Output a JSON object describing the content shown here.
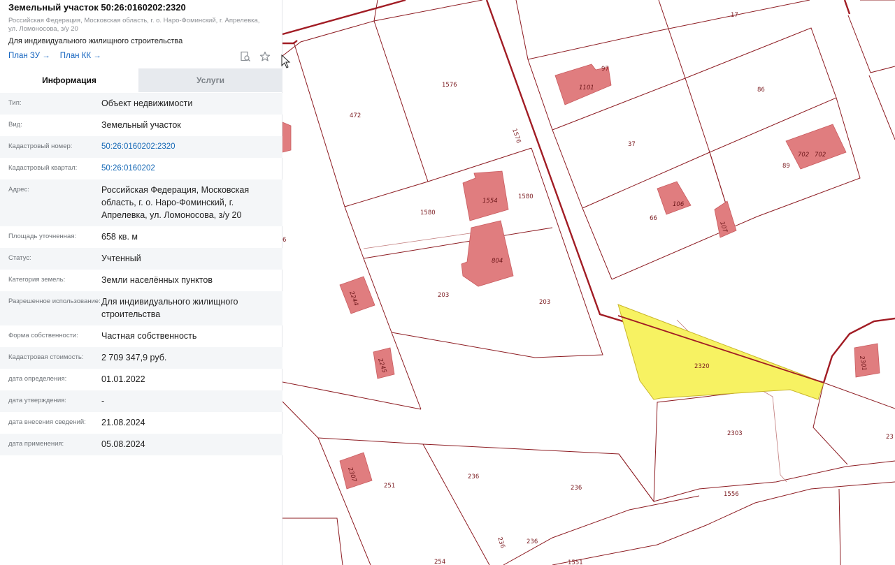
{
  "header": {
    "title": "Земельный участок 50:26:0160202:2320",
    "address": "Российская Федерация, Московская область, г. о. Наро-Фоминский, г. Апрелевка, ул. Ломоносова, з/у 20",
    "usage": "Для индивидуального жилищного строительства",
    "link_zu": "План ЗУ →",
    "link_kk": "План КК →",
    "icons": [
      "search-document-icon",
      "star-icon"
    ]
  },
  "tabs": [
    {
      "label": "Информация",
      "active": true
    },
    {
      "label": "Услуги",
      "active": false
    }
  ],
  "info": [
    {
      "label": "Тип:",
      "value": "Объект недвижимости"
    },
    {
      "label": "Вид:",
      "value": "Земельный участок"
    },
    {
      "label": "Кадастровый номер:",
      "value": "50:26:0160202:2320",
      "link": true
    },
    {
      "label": "Кадастровый квартал:",
      "value": "50:26:0160202",
      "link": true
    },
    {
      "label": "Адрес:",
      "value": "Российская Федерация, Московская область, г. о. Наро-Фоминский, г. Апрелевка, ул. Ломоносова, з/у 20"
    },
    {
      "label": "Площадь уточненная:",
      "value": "658 кв. м"
    },
    {
      "label": "Статус:",
      "value": "Учтенный"
    },
    {
      "label": "Категория земель:",
      "value": "Земли населённых пунктов"
    },
    {
      "label": "Разрешенное использование:",
      "value": "Для индивидуального жилищного строительства"
    },
    {
      "label": "Форма собственности:",
      "value": "Частная собственность"
    },
    {
      "label": "Кадастровая стоимость:",
      "value": "2 709 347,9 руб."
    },
    {
      "label": "дата определения:",
      "value": "01.01.2022"
    },
    {
      "label": "дата утверждения:",
      "value": "-"
    },
    {
      "label": "дата внесения сведений:",
      "value": "21.08.2024"
    },
    {
      "label": "дата применения:",
      "value": "05.08.2024"
    }
  ],
  "map": {
    "highlight_color": "#f7f262",
    "boundary_color": "#a11c24",
    "building_color": "#e07d7f",
    "parcel_labels": [
      "17",
      "97",
      "1101",
      "86",
      "1576",
      "472",
      "1576",
      "37",
      "89",
      "702",
      "702",
      "1554",
      "1580",
      "1580",
      "106",
      "66",
      "107",
      "804",
      "203",
      "203",
      "2244",
      "2320",
      "2245",
      "2301",
      "2303",
      "23",
      "2307",
      "251",
      "236",
      "236",
      "236",
      "236",
      "1556",
      "6",
      "254",
      "1551"
    ]
  }
}
